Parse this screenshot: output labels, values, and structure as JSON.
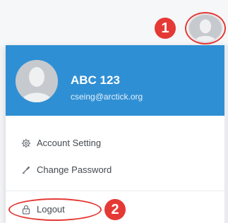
{
  "callouts": {
    "first": "1",
    "second": "2"
  },
  "user": {
    "name": "ABC 123",
    "email": "cseing@arctick.org"
  },
  "menu": {
    "items": [
      {
        "label": "Account Setting",
        "icon": "gear-icon"
      },
      {
        "label": "Change Password",
        "icon": "key-icon"
      },
      {
        "label": "Logout",
        "icon": "lock-icon"
      }
    ]
  },
  "colors": {
    "header": "#2f8fd4",
    "callout": "#e53935"
  }
}
